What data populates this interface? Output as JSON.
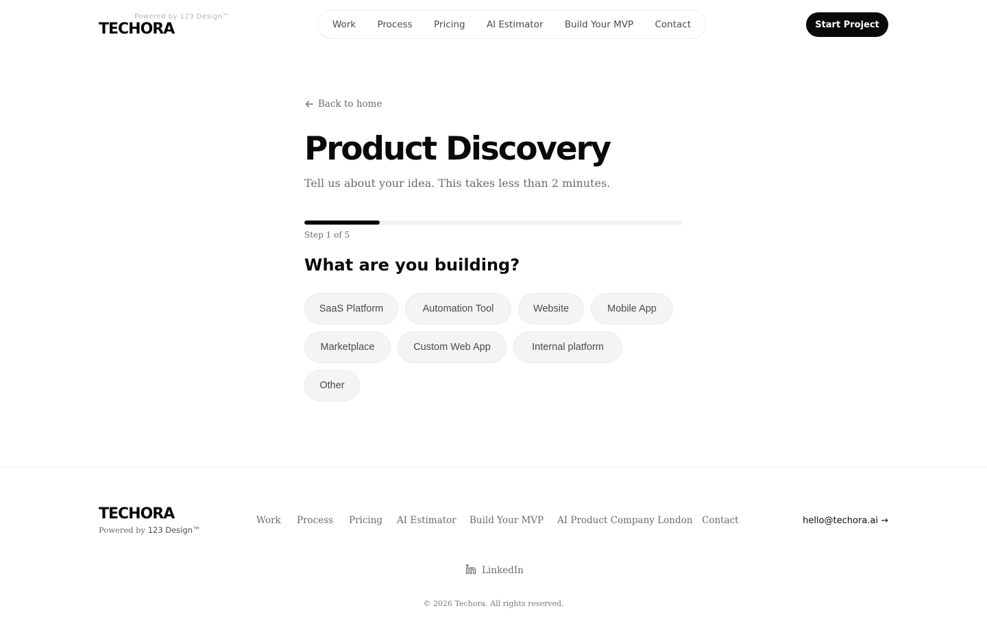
{
  "header": {
    "logo": "TECHORA",
    "powered_by": "Powered by 123 Design™",
    "nav": [
      "Work",
      "Process",
      "Pricing",
      "AI Estimator",
      "Build Your MVP",
      "Contact"
    ],
    "cta_label": "Start Project"
  },
  "main": {
    "back_label": "Back to home",
    "title": "Product Discovery",
    "subtitle": "Tell us about your idea. This takes less than 2 minutes.",
    "progress": {
      "current": 1,
      "total": 5
    },
    "step_label": "Step 1 of 5",
    "question": "What are you building?",
    "options": [
      "SaaS Platform",
      "Automation Tool",
      "Website",
      "Mobile App",
      "Marketplace",
      "Custom Web App",
      "Internal platform",
      "Other"
    ]
  },
  "footer": {
    "logo": "TECHORA",
    "powered_prefix": "Powered by",
    "powered_brand": "123 Design™",
    "links": [
      "Work",
      "Process",
      "Pricing",
      "AI Estimator",
      "Build Your MVP",
      "AI Product Company London",
      "Contact"
    ],
    "email": "hello@techora.ai →",
    "social_label": "LinkedIn",
    "copyright": "© 2026 Techora. All rights reserved."
  },
  "icons": {
    "back": "arrow-left-icon",
    "social": "linkedin-icon"
  },
  "colors": {
    "text": "#0a0a0a",
    "muted": "#6b6b6b",
    "cta_bg": "#0a0a0a",
    "option_bg": "#f4f4f4"
  }
}
